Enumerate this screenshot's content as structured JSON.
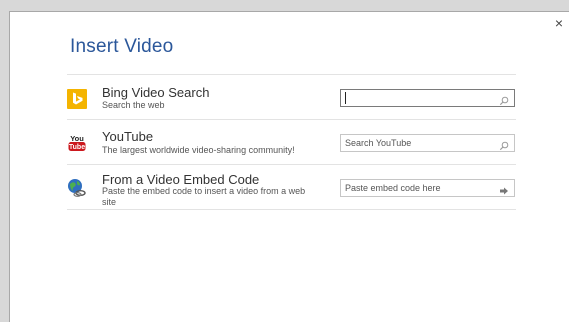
{
  "dialog": {
    "title": "Insert Video",
    "close_glyph": "×"
  },
  "sources": [
    {
      "icon": "bing-icon",
      "name": "Bing Video Search",
      "description": "Search the web",
      "field_value": "",
      "field_placeholder": "",
      "action_icon": "search-icon"
    },
    {
      "icon": "youtube-icon",
      "name": "YouTube",
      "description": "The largest worldwide video-sharing community!",
      "field_value": "",
      "field_placeholder": "Search YouTube",
      "action_icon": "search-icon"
    },
    {
      "icon": "globe-link-icon",
      "name": "From a Video Embed Code",
      "description": "Paste the embed code to insert a video from a web site",
      "field_value": "",
      "field_placeholder": "Paste embed code here",
      "action_icon": "arrow-right-icon"
    }
  ],
  "colors": {
    "title": "#2b579a",
    "bing": "#f4b400",
    "youtube": "#cc181e"
  }
}
